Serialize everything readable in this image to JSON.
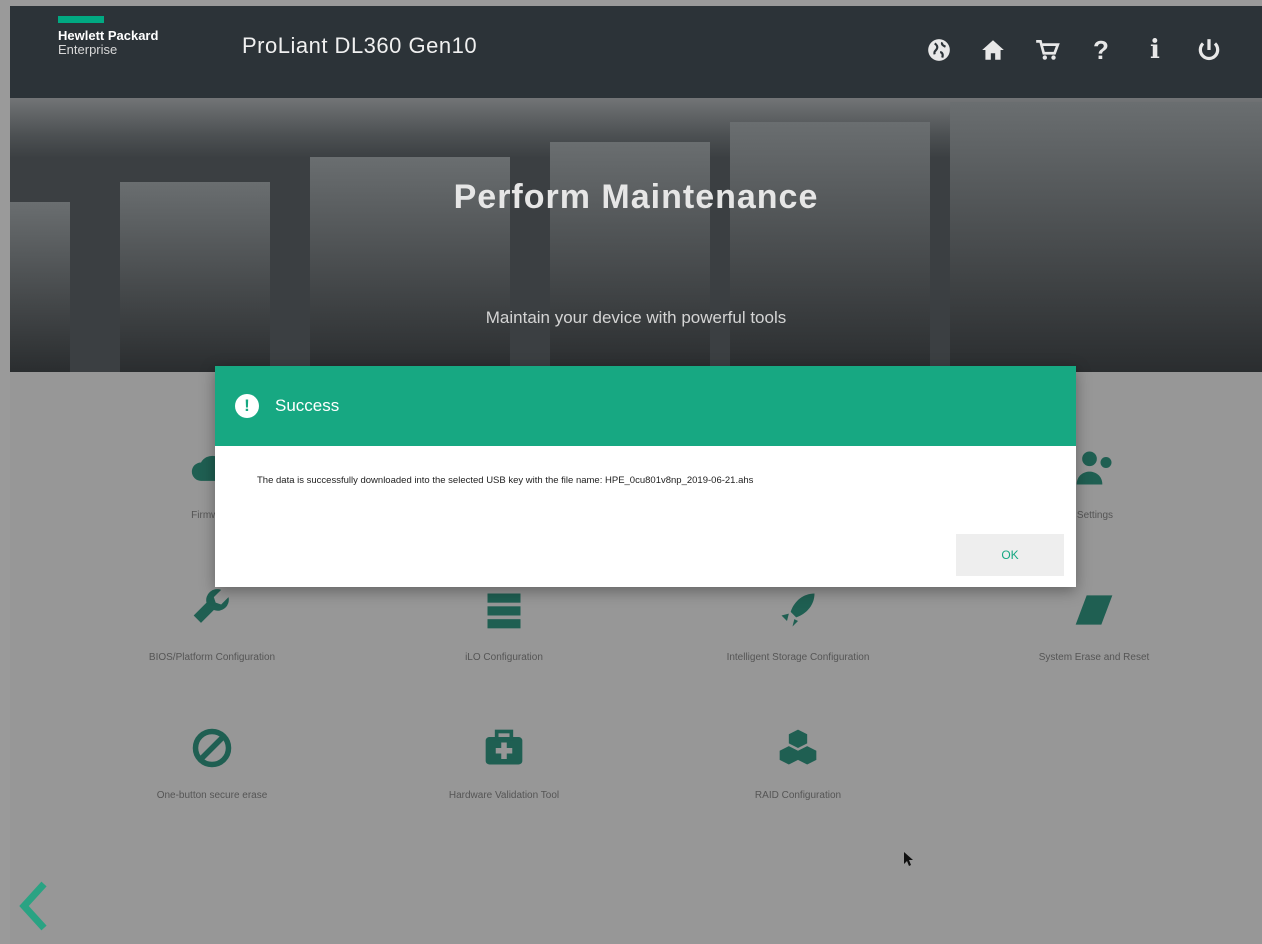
{
  "header": {
    "brand_line1": "Hewlett Packard",
    "brand_line2": "Enterprise",
    "product": "ProLiant DL360 Gen10",
    "icons": [
      "globe-icon",
      "home-icon",
      "cart-icon",
      "help-icon",
      "info-icon",
      "power-icon"
    ],
    "help_glyph": "?",
    "info_glyph": "i"
  },
  "hero": {
    "title": "Perform Maintenance",
    "subtitle": "Maintain your device with powerful tools"
  },
  "tiles": [
    {
      "label": "Firmware"
    },
    {
      "label": "Settings"
    },
    {
      "label": "BIOS/Platform Configuration"
    },
    {
      "label": "iLO Configuration"
    },
    {
      "label": "Intelligent Storage Configuration"
    },
    {
      "label": "System Erase and Reset"
    },
    {
      "label": "One-button secure erase"
    },
    {
      "label": "Hardware Validation Tool"
    },
    {
      "label": "RAID Configuration"
    }
  ],
  "modal": {
    "title": "Success",
    "message": "The data is successfully downloaded into the selected USB key with the file name: HPE_0cu801v8np_2019-06-21.ahs",
    "ok_label": "OK"
  },
  "colors": {
    "accent": "#17a882",
    "topbar": "#2c3338",
    "overlay": "#979797"
  }
}
